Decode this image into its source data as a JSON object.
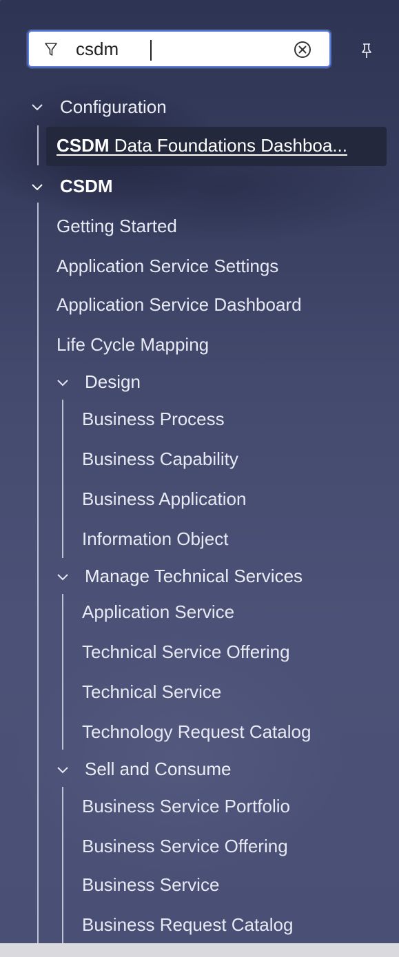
{
  "search": {
    "value": "csdm",
    "filter_icon": "filter-icon",
    "clear_icon": "clear-circle-x-icon",
    "pin_icon": "pin-icon"
  },
  "tree": {
    "configuration": {
      "label": "Configuration",
      "children": [
        {
          "match": "CSDM",
          "rest": " Data Foundations Dashboa..."
        }
      ]
    },
    "csdm": {
      "label": "CSDM",
      "items": [
        "Getting Started",
        "Application Service Settings",
        "Application Service Dashboard",
        "Life Cycle Mapping"
      ],
      "design": {
        "label": "Design",
        "items": [
          "Business Process",
          "Business Capability",
          "Business Application",
          "Information Object"
        ]
      },
      "manage": {
        "label": "Manage Technical Services",
        "items": [
          "Application Service",
          "Technical Service Offering",
          "Technical Service",
          "Technology Request Catalog"
        ]
      },
      "sell": {
        "label": "Sell and Consume",
        "items": [
          "Business Service Portfolio",
          "Business Service Offering",
          "Business Service",
          "Business Request Catalog"
        ]
      }
    }
  },
  "colors": {
    "selected_bg": "#23283c",
    "search_border": "#5b7fe0",
    "text": "#eceef6"
  }
}
